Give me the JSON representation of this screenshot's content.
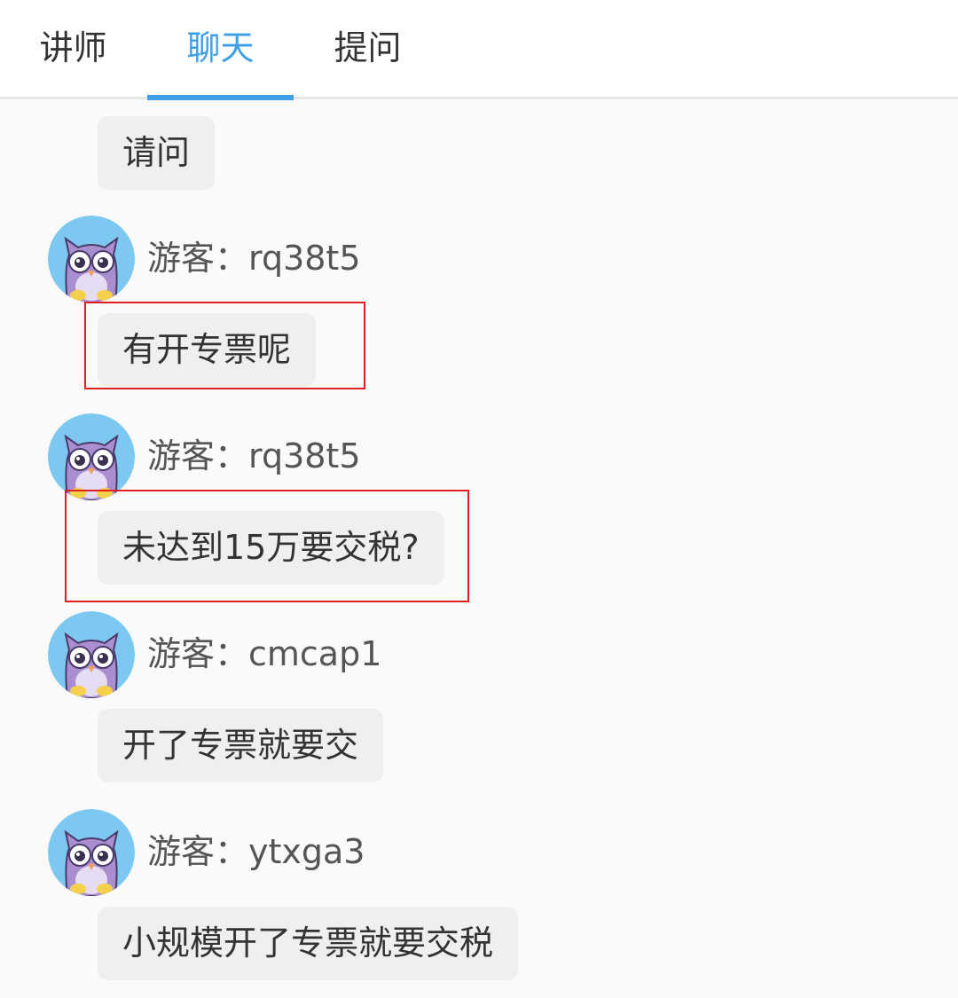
{
  "tabs": [
    {
      "label": "讲师"
    },
    {
      "label": "聊天"
    },
    {
      "label": "提问"
    }
  ],
  "active_tab": "聊天",
  "colors": {
    "accent": "#3d9fe6",
    "bubble": "#efefef",
    "highlight": "#e02020",
    "avatar_bg": "#7cc8f0",
    "owl": "#a98fd0"
  },
  "messages": [
    {
      "text": "请问"
    },
    {
      "user": "游客：rq38t5",
      "text": "有开专票呢",
      "avatar_icon": "owl-avatar-icon"
    },
    {
      "user": "游客：rq38t5",
      "text": "未达到15万要交税?",
      "avatar_icon": "owl-avatar-icon"
    },
    {
      "user": "游客：cmcap1",
      "text": "开了专票就要交",
      "avatar_icon": "owl-avatar-icon"
    },
    {
      "user": "游客：ytxga3",
      "text": "小规模开了专票就要交税",
      "avatar_icon": "owl-avatar-icon"
    }
  ]
}
